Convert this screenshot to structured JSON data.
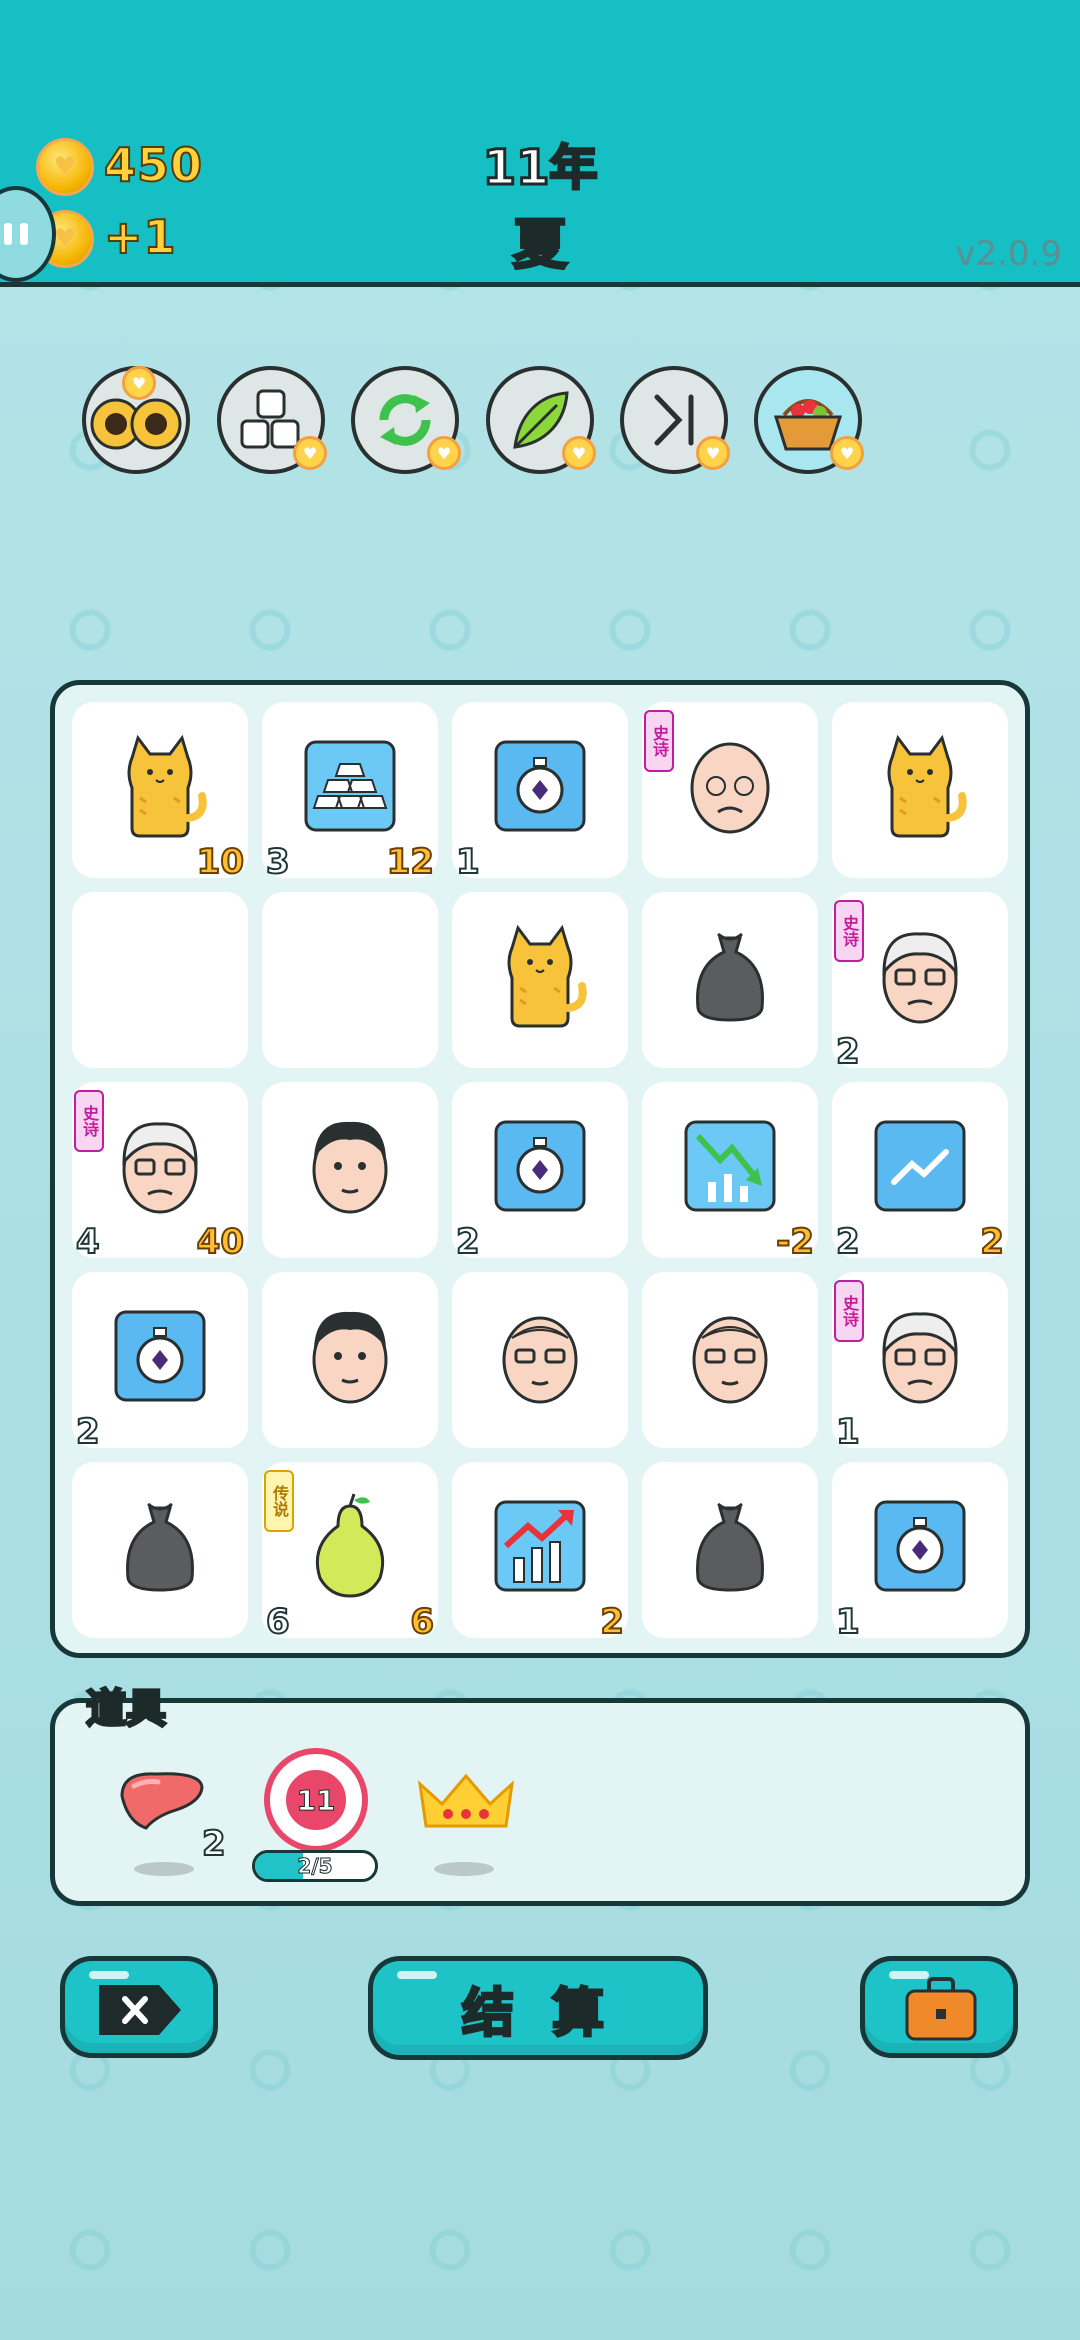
{
  "header": {
    "coins": "450",
    "coin_delta": "+1",
    "year": "11年",
    "season": "夏",
    "version": "v2.0.9"
  },
  "tools": [
    {
      "name": "cats-peek-icon"
    },
    {
      "name": "blocks-icon"
    },
    {
      "name": "refresh-icon"
    },
    {
      "name": "leaf-icon"
    },
    {
      "name": "skip-icon"
    },
    {
      "name": "fruit-basket-icon"
    }
  ],
  "board": {
    "rows": [
      [
        {
          "item": "cat",
          "count": "",
          "value": "10",
          "tag": ""
        },
        {
          "item": "silver-bars",
          "count": "3",
          "value": "12",
          "tag": ""
        },
        {
          "item": "stopwatch",
          "count": "1",
          "value": "",
          "tag": ""
        },
        {
          "item": "bald-old-man",
          "count": "",
          "value": "",
          "tag": "史诗"
        },
        {
          "item": "cat",
          "count": "",
          "value": "",
          "tag": ""
        }
      ],
      [
        {
          "item": "empty",
          "count": "",
          "value": "",
          "tag": ""
        },
        {
          "item": "empty",
          "count": "",
          "value": "",
          "tag": ""
        },
        {
          "item": "cat",
          "count": "",
          "value": "",
          "tag": ""
        },
        {
          "item": "trash-bag",
          "count": "",
          "value": "",
          "tag": ""
        },
        {
          "item": "grandpa",
          "count": "2",
          "value": "",
          "tag": "史诗"
        }
      ],
      [
        {
          "item": "grandpa",
          "count": "4",
          "value": "40",
          "tag": "史诗"
        },
        {
          "item": "young-man",
          "count": "",
          "value": "",
          "tag": ""
        },
        {
          "item": "stopwatch",
          "count": "2",
          "value": "",
          "tag": ""
        },
        {
          "item": "chart-down",
          "count": "",
          "value": "-2",
          "tag": ""
        },
        {
          "item": "chart-up-card",
          "count": "2",
          "value": "2",
          "tag": ""
        }
      ],
      [
        {
          "item": "stopwatch",
          "count": "2",
          "value": "",
          "tag": ""
        },
        {
          "item": "young-man",
          "count": "",
          "value": "",
          "tag": ""
        },
        {
          "item": "glasses-man",
          "count": "",
          "value": "",
          "tag": ""
        },
        {
          "item": "glasses-man",
          "count": "",
          "value": "",
          "tag": ""
        },
        {
          "item": "grandpa",
          "count": "1",
          "value": "",
          "tag": "史诗"
        }
      ],
      [
        {
          "item": "trash-bag",
          "count": "",
          "value": "",
          "tag": ""
        },
        {
          "item": "pear",
          "count": "6",
          "value": "6",
          "tag": "传说"
        },
        {
          "item": "chart-up",
          "count": "",
          "value": "2",
          "tag": ""
        },
        {
          "item": "trash-bag",
          "count": "",
          "value": "",
          "tag": ""
        },
        {
          "item": "stopwatch",
          "count": "1",
          "value": "",
          "tag": ""
        }
      ]
    ]
  },
  "props": {
    "title": "道具",
    "liver_count": "2",
    "target_number": "11",
    "target_progress": "2/5",
    "target_progress_fraction": 0.4
  },
  "buttons": {
    "settle_label": "结 算"
  },
  "colors": {
    "header": "#16bfc4",
    "background": "#a9dde2",
    "button": "#1ec3c8",
    "coin": "#ffd23d",
    "epic_tag": "#c21d9e",
    "legend_tag": "#d8a500"
  }
}
